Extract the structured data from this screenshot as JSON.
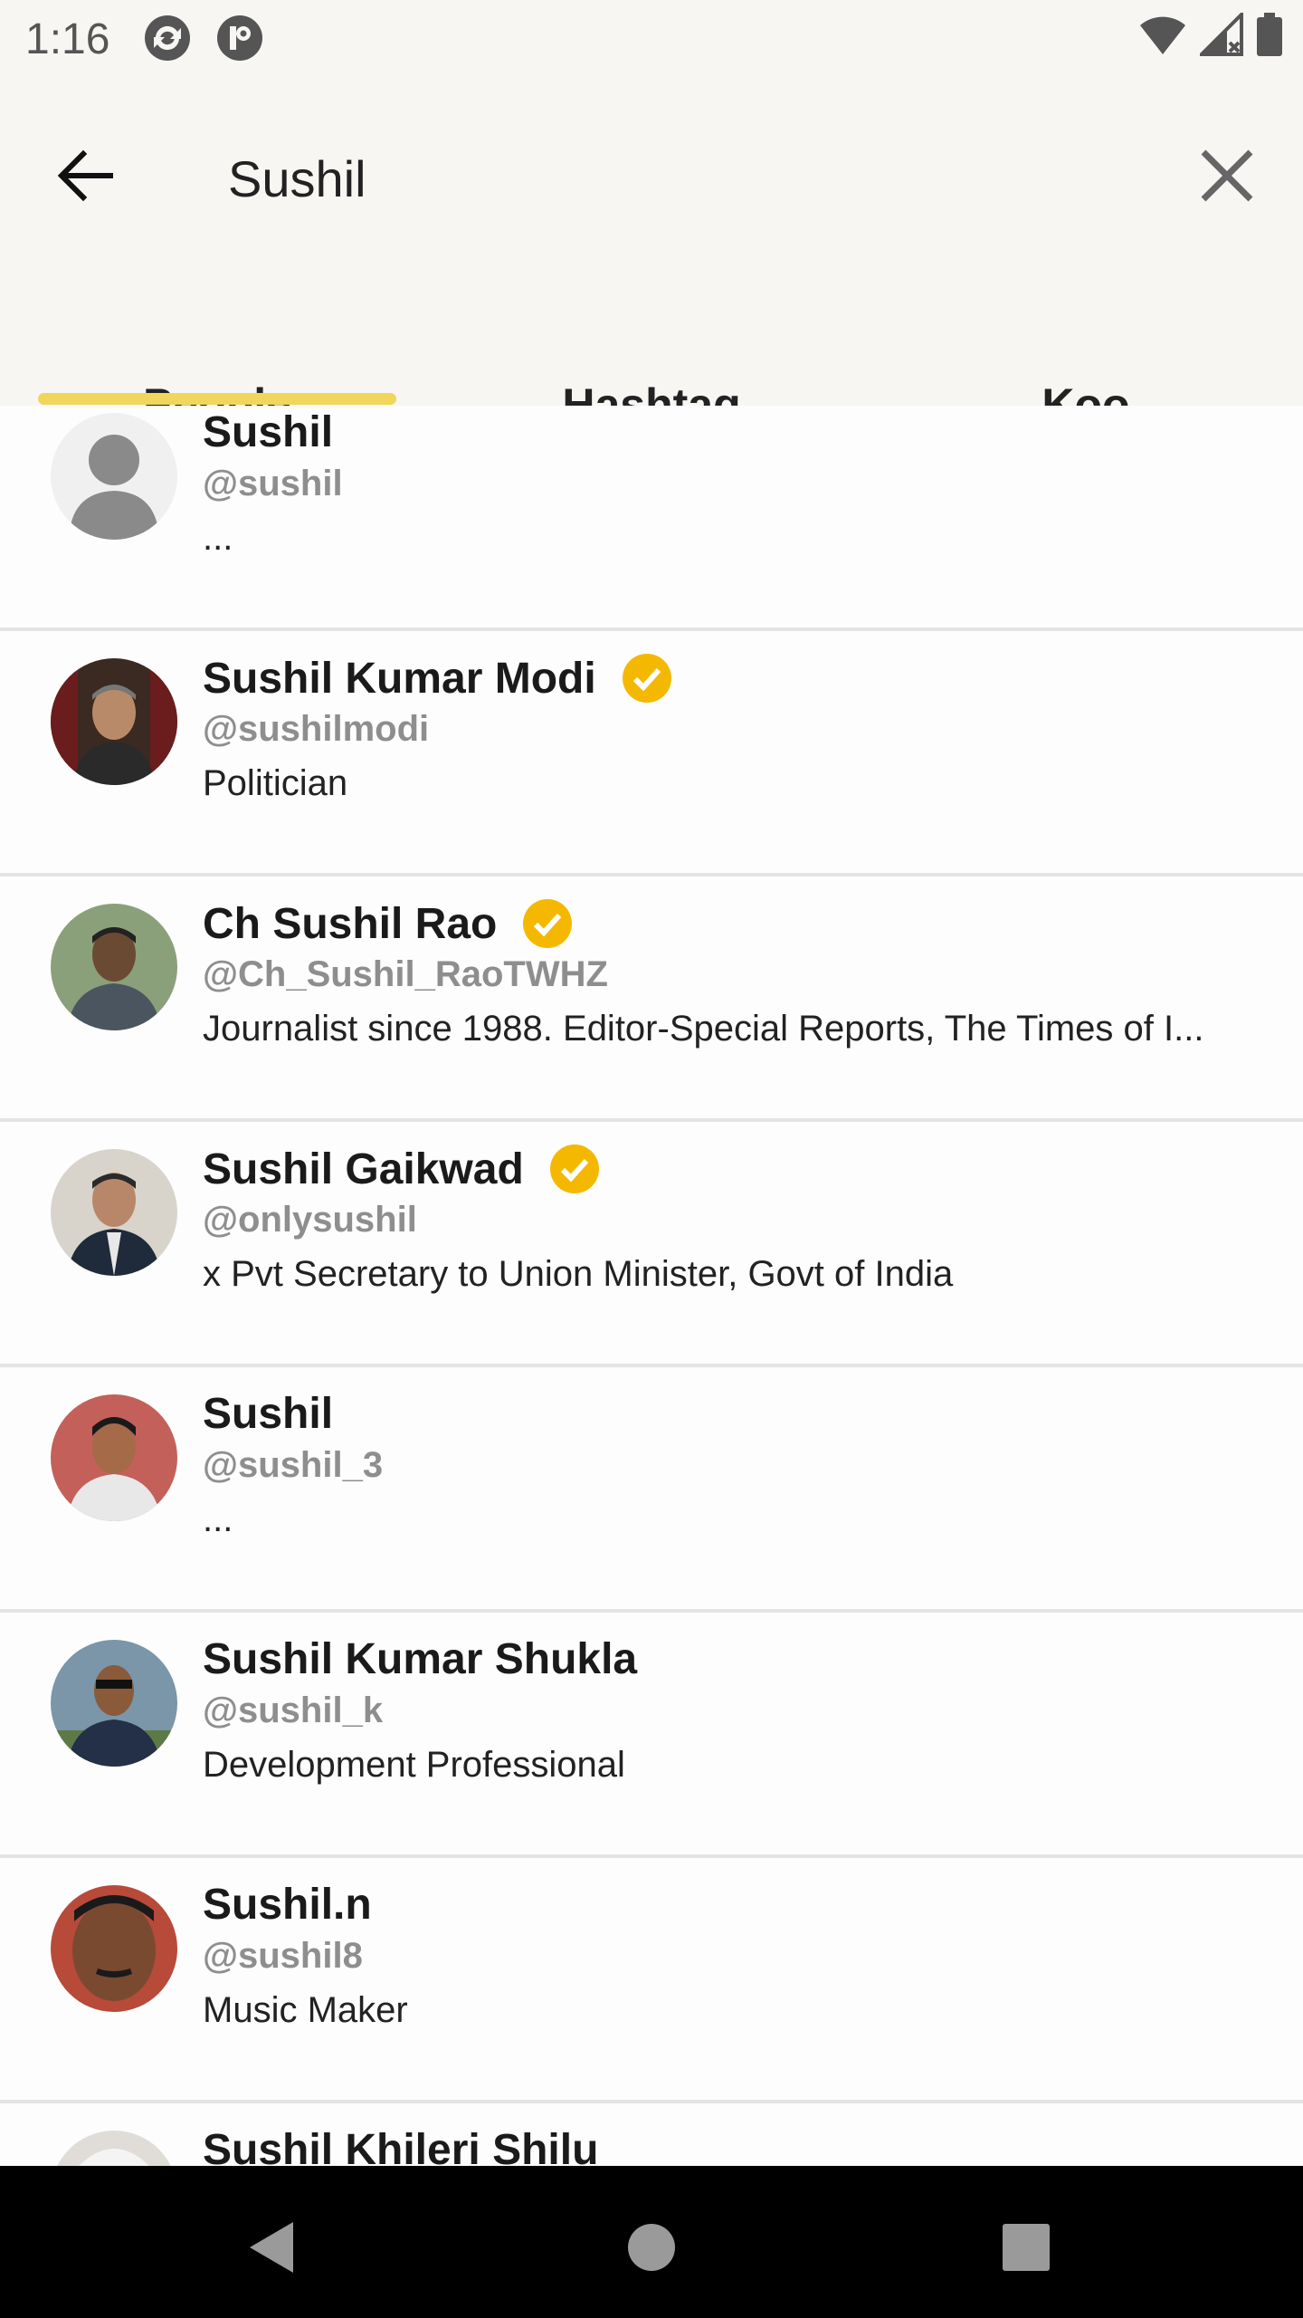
{
  "status": {
    "time": "1:16"
  },
  "search": {
    "value": "Sushil",
    "placeholder": ""
  },
  "tabs": [
    {
      "label": "People"
    },
    {
      "label": "Hashtag"
    },
    {
      "label": "Koo"
    }
  ],
  "results": [
    {
      "name": "Sushil",
      "handle": "@sushil",
      "bio": "...",
      "verified": false
    },
    {
      "name": "Sushil Kumar Modi",
      "handle": "@sushilmodi",
      "bio": "Politician",
      "verified": true
    },
    {
      "name": "Ch Sushil Rao",
      "handle": "@Ch_Sushil_RaoTWHZ",
      "bio": "Journalist since 1988. Editor-Special Reports, The Times of I...",
      "verified": true
    },
    {
      "name": "Sushil Gaikwad",
      "handle": "@onlysushil",
      "bio": "x Pvt Secretary to Union Minister, Govt of India",
      "verified": true
    },
    {
      "name": "Sushil",
      "handle": "@sushil_3",
      "bio": "...",
      "verified": false
    },
    {
      "name": "Sushil Kumar Shukla",
      "handle": "@sushil_k",
      "bio": "Development Professional",
      "verified": false
    },
    {
      "name": "Sushil.n",
      "handle": "@sushil8",
      "bio": "Music Maker",
      "verified": false
    },
    {
      "name": "Sushil Khileri Shilu",
      "handle": "",
      "bio": "",
      "verified": false
    }
  ],
  "colors": {
    "accent": "#f2d65b",
    "verified": "#f5b800",
    "header_bg": "#f7f6f3",
    "handle": "#8e8e8e"
  },
  "icons": {
    "back": "arrow-left-icon",
    "clear": "close-icon",
    "verified": "verified-check-icon"
  }
}
